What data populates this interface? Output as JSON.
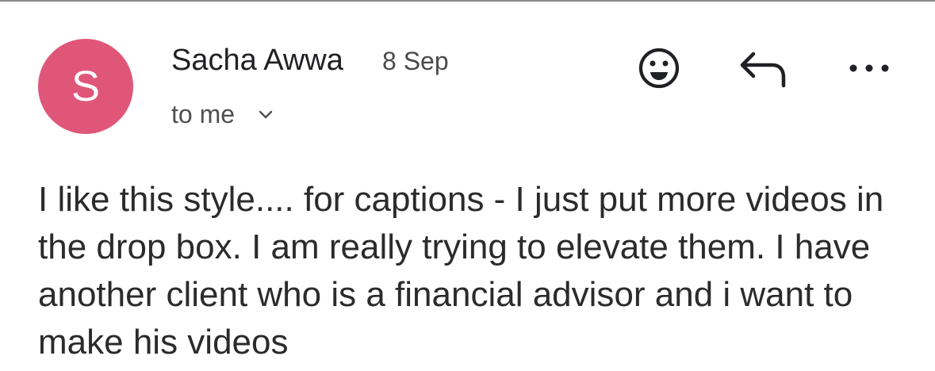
{
  "message": {
    "avatar_letter": "S",
    "sender_name": "Sacha Awwa",
    "date": "8 Sep",
    "recipient": "to me",
    "body": "I like this style.... for captions - I just put more videos in the drop box. I am really trying to elevate them. I have another client who is a financial advisor and i want to make his videos"
  },
  "icons": {
    "avatar": "person-avatar",
    "expand_details": "chevron-down-icon",
    "reaction": "smiley-emoji-icon",
    "reply": "reply-arrow-icon",
    "more": "more-horizontal-icon"
  },
  "colors": {
    "avatar_background": "#e05679",
    "avatar_text": "#ffffff",
    "text_primary": "#202124",
    "text_secondary": "#4f4f4f"
  }
}
